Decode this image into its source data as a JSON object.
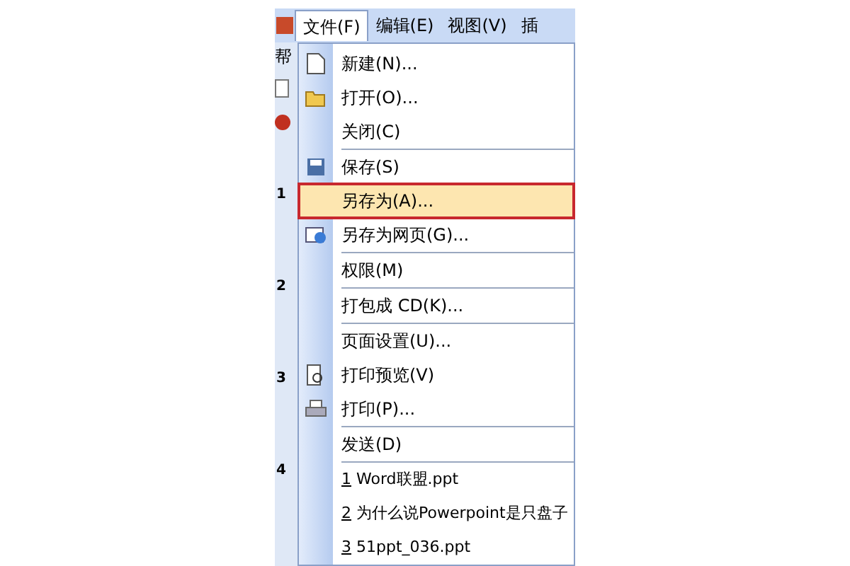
{
  "menu_bar": [
    {
      "label": "文件(F)",
      "selected": true
    },
    {
      "label": "编辑(E)",
      "selected": false
    },
    {
      "label": "视图(V)",
      "selected": false
    },
    {
      "label": "插",
      "selected": false
    }
  ],
  "left_strip": {
    "toolbar_label": "帮",
    "slide_numbers": [
      "1",
      "2",
      "3",
      "4"
    ]
  },
  "file_menu": [
    {
      "kind": "command",
      "label": "新建(N)...",
      "selected": false,
      "outlined": false,
      "divider_above": false
    },
    {
      "kind": "command",
      "label": "打开(O)...",
      "selected": false,
      "outlined": false,
      "divider_above": false
    },
    {
      "kind": "command",
      "label": "关闭(C)",
      "selected": false,
      "outlined": false,
      "divider_above": false
    },
    {
      "kind": "command",
      "label": "保存(S)",
      "selected": false,
      "outlined": false,
      "divider_above": true
    },
    {
      "kind": "command",
      "label": "另存为(A)...",
      "selected": true,
      "outlined": true,
      "divider_above": false
    },
    {
      "kind": "command",
      "label": "另存为网页(G)...",
      "selected": false,
      "outlined": false,
      "divider_above": false
    },
    {
      "kind": "command",
      "label": "权限(M)",
      "selected": false,
      "outlined": false,
      "divider_above": true
    },
    {
      "kind": "command",
      "label": "打包成 CD(K)...",
      "selected": false,
      "outlined": false,
      "divider_above": true
    },
    {
      "kind": "command",
      "label": "页面设置(U)...",
      "selected": false,
      "outlined": false,
      "divider_above": true
    },
    {
      "kind": "command",
      "label": "打印预览(V)",
      "selected": false,
      "outlined": false,
      "divider_above": false
    },
    {
      "kind": "command",
      "label": "打印(P)...",
      "selected": false,
      "outlined": false,
      "divider_above": false
    },
    {
      "kind": "command",
      "label": "发送(D)",
      "selected": false,
      "outlined": false,
      "divider_above": true
    },
    {
      "kind": "recent",
      "number": "1",
      "label": "Word联盟.ppt",
      "selected": false,
      "outlined": false,
      "divider_above": true
    },
    {
      "kind": "recent",
      "number": "2",
      "label": "为什么说Powerpoint是只盘子",
      "selected": false,
      "outlined": false,
      "divider_above": false
    },
    {
      "kind": "recent",
      "number": "3",
      "label": "51ppt_036.ppt",
      "selected": false,
      "outlined": false,
      "divider_above": false
    }
  ]
}
